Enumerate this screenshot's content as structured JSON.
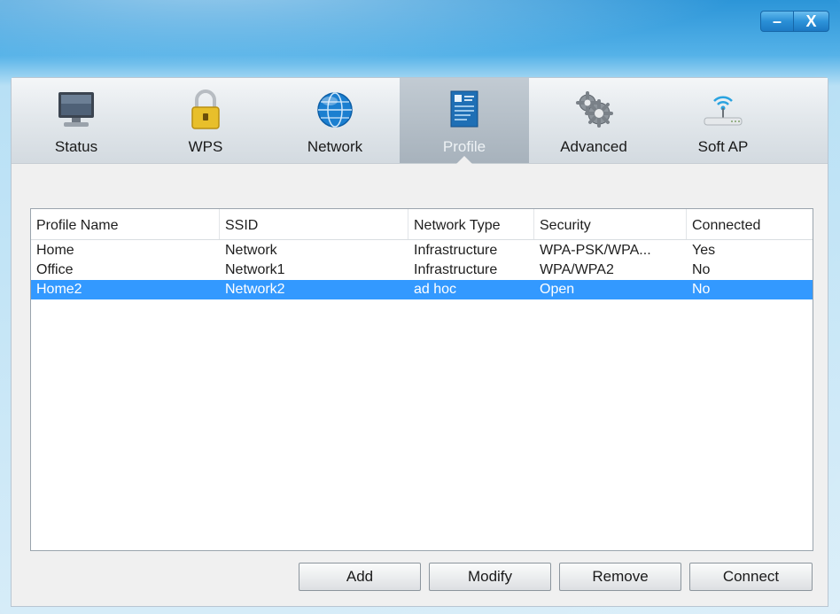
{
  "window": {
    "minimize_label": "–",
    "close_label": "X"
  },
  "tabs": [
    {
      "label": "Status",
      "icon": "monitor-icon"
    },
    {
      "label": "WPS",
      "icon": "padlock-icon"
    },
    {
      "label": "Network",
      "icon": "globe-icon"
    },
    {
      "label": "Profile",
      "icon": "document-icon",
      "active": true
    },
    {
      "label": "Advanced",
      "icon": "gears-icon"
    },
    {
      "label": "Soft AP",
      "icon": "router-icon"
    }
  ],
  "profiles": {
    "columns": [
      "Profile Name",
      "SSID",
      "Network Type",
      "Security",
      "Connected"
    ],
    "rows": [
      {
        "name": "Home",
        "ssid": "Network",
        "type": "Infrastructure",
        "security": "WPA-PSK/WPA...",
        "connected": "Yes"
      },
      {
        "name": "Office",
        "ssid": "Network1",
        "type": "Infrastructure",
        "security": "WPA/WPA2",
        "connected": "No"
      },
      {
        "name": "Home2",
        "ssid": "Network2",
        "type": "ad hoc",
        "security": "Open",
        "connected": "No",
        "selected": true
      }
    ]
  },
  "buttons": {
    "add": "Add",
    "modify": "Modify",
    "remove": "Remove",
    "connect": "Connect"
  },
  "colors": {
    "selection": "#3399ff",
    "title_bar": "#2c95d8"
  }
}
